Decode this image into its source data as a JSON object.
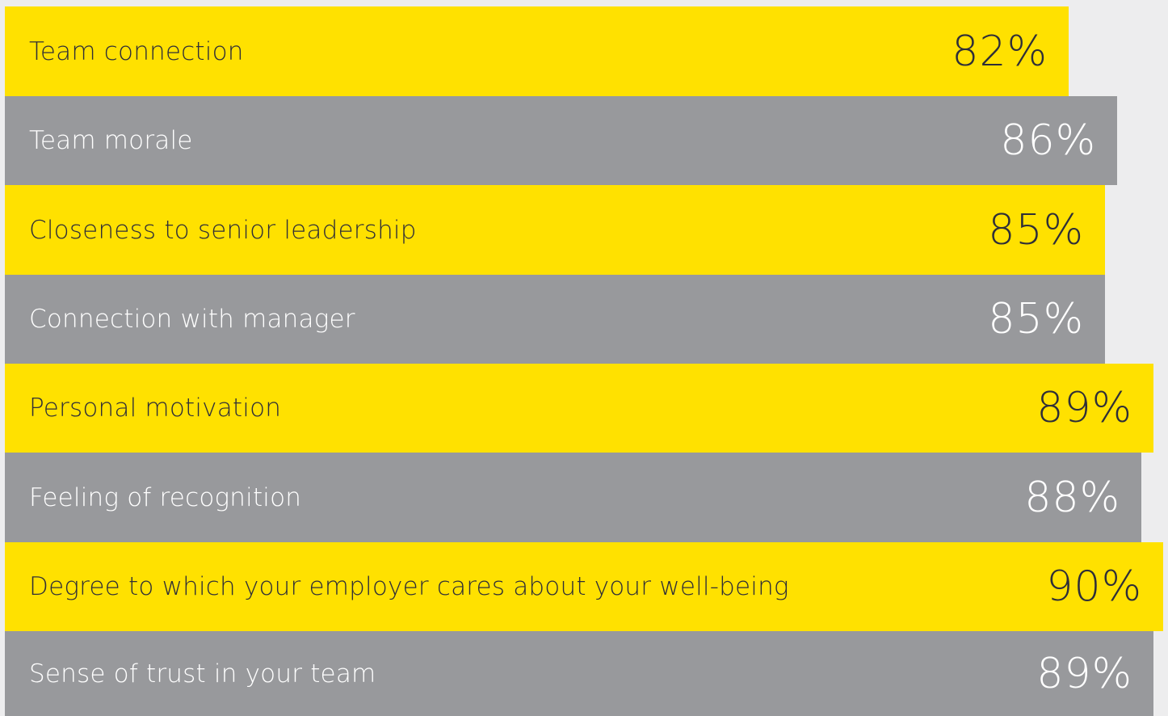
{
  "chart_data": {
    "type": "bar",
    "orientation": "horizontal",
    "categories": [
      "Team connection",
      "Team morale",
      "Closeness to senior leadership",
      "Connection with manager",
      "Personal motivation",
      "Feeling of recognition",
      "Degree to which your employer cares about your well-being",
      "Sense of trust in your team"
    ],
    "values": [
      82,
      86,
      85,
      85,
      89,
      88,
      90,
      89
    ],
    "value_labels": [
      "82%",
      "86%",
      "85%",
      "85%",
      "89%",
      "88%",
      "90%",
      "89%"
    ],
    "unit": "%",
    "grid": false,
    "legend": "none"
  },
  "colors": {
    "background": "#ededee",
    "yellow_bar": "#ffe100",
    "grey_bar": "#98999c",
    "text_on_yellow": "#2e2e38",
    "text_on_grey": "#ffffff"
  }
}
